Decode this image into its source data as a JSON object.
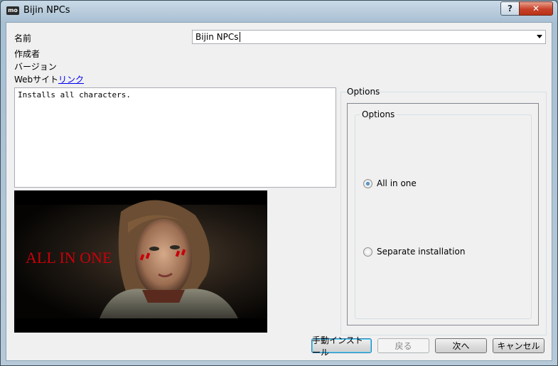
{
  "window": {
    "app_icon": "mo",
    "title": "Bijin NPCs",
    "help_label": "?",
    "close_label": "✕"
  },
  "info": {
    "name_label": "名前",
    "name_value": "Bijin NPCs",
    "author_label": "作成者",
    "version_label": "バージョン",
    "website_label": "Webサイト",
    "website_link": "リンク",
    "description": "Installs all characters."
  },
  "preview": {
    "overlay_text": "ALL IN ONE",
    "accent": "#c8000a"
  },
  "options": {
    "outer_label": "Options",
    "group_label": "Options",
    "choices": [
      {
        "label": "All in one",
        "selected": true
      },
      {
        "label": "Separate installation",
        "selected": false
      }
    ]
  },
  "buttons": {
    "manual": "手動インストール",
    "back": "戻る",
    "next": "次へ",
    "cancel": "キャンセル"
  }
}
